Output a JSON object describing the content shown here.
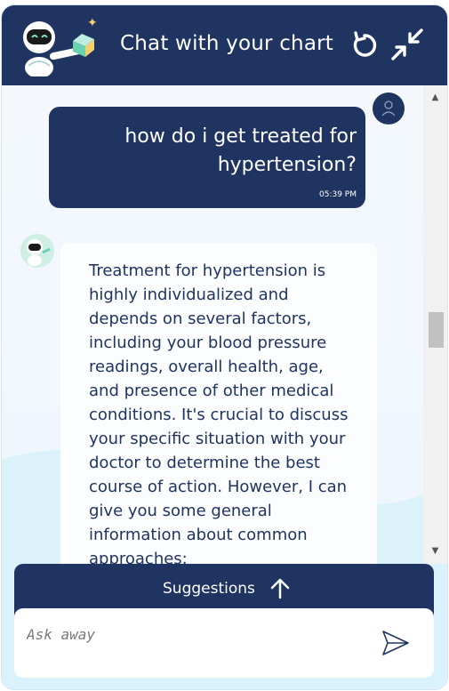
{
  "header": {
    "title": "Chat with your chart",
    "logo_icon": "robot-with-book-icon",
    "refresh_icon": "refresh-icon",
    "collapse_icon": "collapse-icon"
  },
  "messages": [
    {
      "role": "user",
      "text": "how do i get treated for hypertension?",
      "time": "05:39 PM"
    },
    {
      "role": "bot",
      "text": "Treatment for hypertension is highly individualized and depends on several factors, including your blood pressure readings, overall health, age, and presence of other medical conditions. It's crucial to discuss your specific situation with your doctor to determine the best course of action. However, I can give you some general information about common approaches:"
    }
  ],
  "suggestions": {
    "label": "Suggestions"
  },
  "input": {
    "placeholder": "Ask away",
    "value": ""
  },
  "colors": {
    "primary": "#1f3461",
    "background": "#eef6fd",
    "accent": "#d9f2fb"
  }
}
